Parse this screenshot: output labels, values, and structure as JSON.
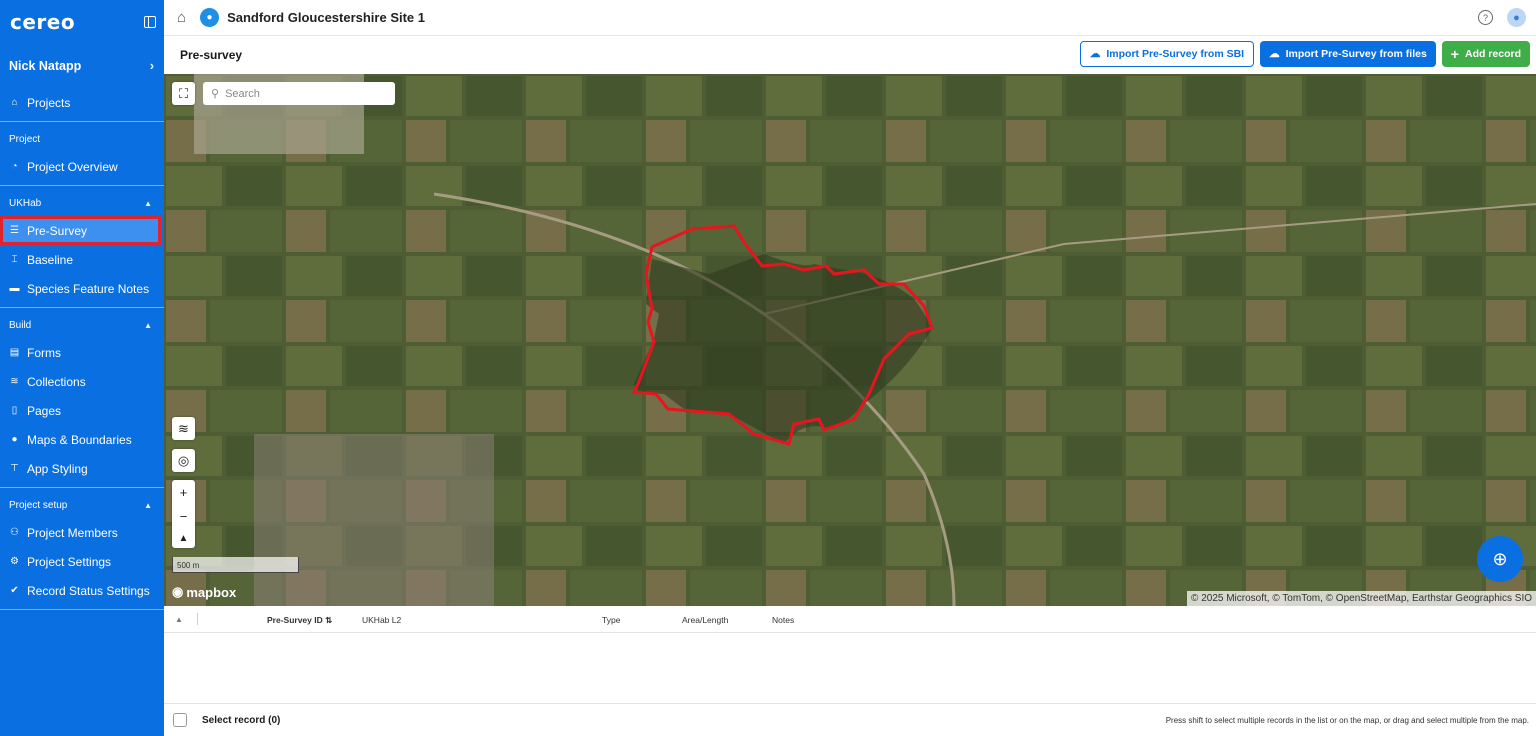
{
  "app": {
    "logo": "cereo"
  },
  "sidebar": {
    "user": "Nick Natapp",
    "projects": "Projects",
    "sections": [
      {
        "title": "Project",
        "items": [
          "Project Overview"
        ]
      },
      {
        "title": "UKHab",
        "items": [
          "Pre-Survey",
          "Baseline",
          "Species Feature Notes"
        ]
      },
      {
        "title": "Build",
        "items": [
          "Forms",
          "Collections",
          "Pages",
          "Maps & Boundaries",
          "App Styling"
        ]
      },
      {
        "title": "Project setup",
        "items": [
          "Project Members",
          "Project Settings",
          "Record Status Settings"
        ]
      }
    ],
    "active": "Pre-Survey"
  },
  "header": {
    "site_name": "Sandford Gloucestershire Site 1"
  },
  "page": {
    "title": "Pre-survey",
    "buttons": {
      "import_sbi": "Import Pre-Survey from SBI",
      "import_files": "Import Pre-Survey from files",
      "add_record": "Add record"
    }
  },
  "map": {
    "search_placeholder": "Search",
    "scale": "500 m",
    "brand": "mapbox",
    "attribution": "© 2025 Microsoft, © TomTom, © OpenStreetMap, Earthstar Geographics SIO",
    "boundary_color": "#e8141e"
  },
  "table": {
    "columns": [
      "Pre-Survey ID",
      "UKHab L2",
      "Type",
      "Area/Length",
      "Notes"
    ]
  },
  "footer": {
    "select_record": "Select record (0)",
    "hint": "Press shift to select multiple records in the list or on the map, or drag and select multiple from the map."
  },
  "colors": {
    "primary": "#0a6fe0",
    "success": "#3fae49",
    "highlight": "#e0242e"
  }
}
